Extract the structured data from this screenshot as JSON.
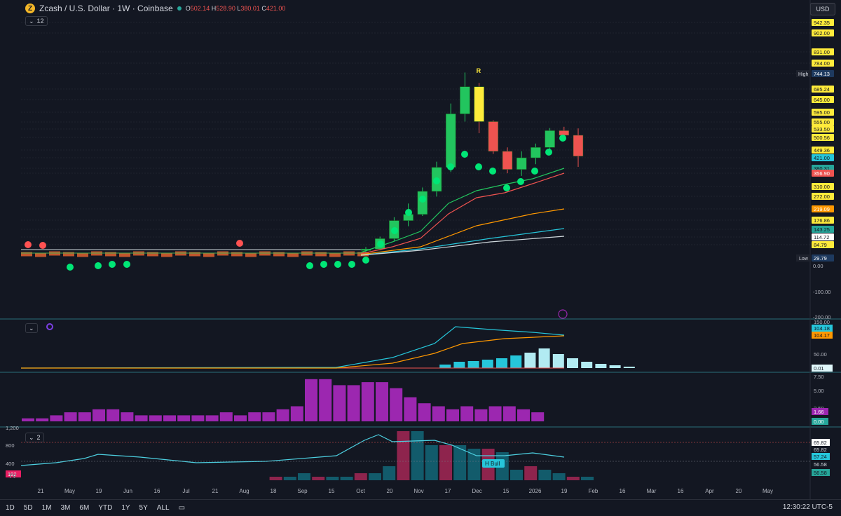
{
  "header": {
    "coin_letter": "Z",
    "symbol": "Zcash / U.S. Dollar · 1W · Coinbase",
    "o_label": "O",
    "o": "502.14",
    "h_label": "H",
    "h": "528.90",
    "l_label": "L",
    "l": "380.01",
    "c_label": "C",
    "c": "421.00",
    "currency": "USD",
    "indicator_count": "12"
  },
  "pane_controls": {
    "pane2_icon": "chevron-down-icon",
    "pane2_marker": "gear-icon",
    "pane4_count": "2"
  },
  "colors": {
    "up": "#26a69a",
    "down": "#ef5350",
    "bull_candle": "#22c55e",
    "dot_green": "#00e676",
    "dot_red": "#ff5252",
    "yellow": "#ffeb3b",
    "cyan": "#26c6da",
    "purple": "#9c27b0",
    "bg": "#131722"
  },
  "price_axis": {
    "ticks": [
      "942.35",
      "902.00",
      "831.00",
      "784.00",
      "744.13",
      "685.24",
      "645.00",
      "595.00",
      "555.00",
      "533.50",
      "500.56",
      "449.36",
      "421.00",
      "380.31",
      "356.90",
      "310.00",
      "272.00",
      "219.09",
      "176.86",
      "143.25",
      "114.72",
      "84.79",
      "29.79",
      "0.00",
      "-100.00",
      "-200.00"
    ],
    "high_label": "High",
    "high_value": "744.13",
    "low_label": "Low",
    "low_value": "29.79",
    "r_marker": "R"
  },
  "time_axis": {
    "labels": [
      "21",
      "May",
      "19",
      "Jun",
      "16",
      "Jul",
      "21",
      "Aug",
      "18",
      "Sep",
      "15",
      "Oct",
      "20",
      "Nov",
      "17",
      "Dec",
      "15",
      "2026",
      "19",
      "Feb",
      "16",
      "Mar",
      "16",
      "Apr",
      "20",
      "May"
    ]
  },
  "macd_pane": {
    "labels": [
      "150.00",
      "104.18",
      "104.17",
      "50.00",
      "0.01"
    ]
  },
  "vol_pane": {
    "labels": [
      "7.50",
      "5.00",
      "2.50",
      "1.66",
      "0.00"
    ]
  },
  "rsi_pane": {
    "left_labels": [
      "1,200",
      "800",
      "400"
    ],
    "right_labels": [
      "65.82",
      "65.82",
      "57.24",
      "56.58",
      "56.58"
    ],
    "left_badge": "132",
    "h_bull": "H Bull"
  },
  "chart_data": {
    "type": "candlestick",
    "title": "Zcash / U.S. Dollar · 1W · Coinbase",
    "y_unit": "USD",
    "ylim": [
      -200,
      942.35
    ],
    "candles": [
      {
        "x": "Oct 06",
        "o": 56,
        "h": 70,
        "l": 48,
        "c": 62
      },
      {
        "x": "Oct 13",
        "o": 62,
        "h": 110,
        "l": 58,
        "c": 102
      },
      {
        "x": "Oct 20",
        "o": 102,
        "h": 185,
        "l": 92,
        "c": 172
      },
      {
        "x": "Oct 27",
        "o": 172,
        "h": 238,
        "l": 150,
        "c": 196
      },
      {
        "x": "Nov 03",
        "o": 196,
        "h": 300,
        "l": 190,
        "c": 285
      },
      {
        "x": "Nov 10",
        "o": 285,
        "h": 400,
        "l": 265,
        "c": 378
      },
      {
        "x": "Nov 17",
        "o": 378,
        "h": 625,
        "l": 360,
        "c": 585
      },
      {
        "x": "Nov 24",
        "o": 585,
        "h": 745,
        "l": 555,
        "c": 690
      },
      {
        "x": "Dec 01",
        "o": 690,
        "h": 705,
        "l": 510,
        "c": 555
      },
      {
        "x": "Dec 08",
        "o": 555,
        "h": 560,
        "l": 430,
        "c": 440
      },
      {
        "x": "Dec 15",
        "o": 440,
        "h": 455,
        "l": 355,
        "c": 370
      },
      {
        "x": "Dec 22",
        "o": 370,
        "h": 440,
        "l": 345,
        "c": 415
      },
      {
        "x": "Dec 29",
        "o": 415,
        "h": 470,
        "l": 390,
        "c": 455
      },
      {
        "x": "Jan 05",
        "o": 455,
        "h": 530,
        "l": 430,
        "c": 520
      },
      {
        "x": "Jan 12",
        "o": 520,
        "h": 535,
        "l": 480,
        "c": 502
      },
      {
        "x": "Jan 19",
        "o": 502.14,
        "h": 528.9,
        "l": 380.01,
        "c": 421.0
      }
    ],
    "legend": "none",
    "grid": true
  }
}
